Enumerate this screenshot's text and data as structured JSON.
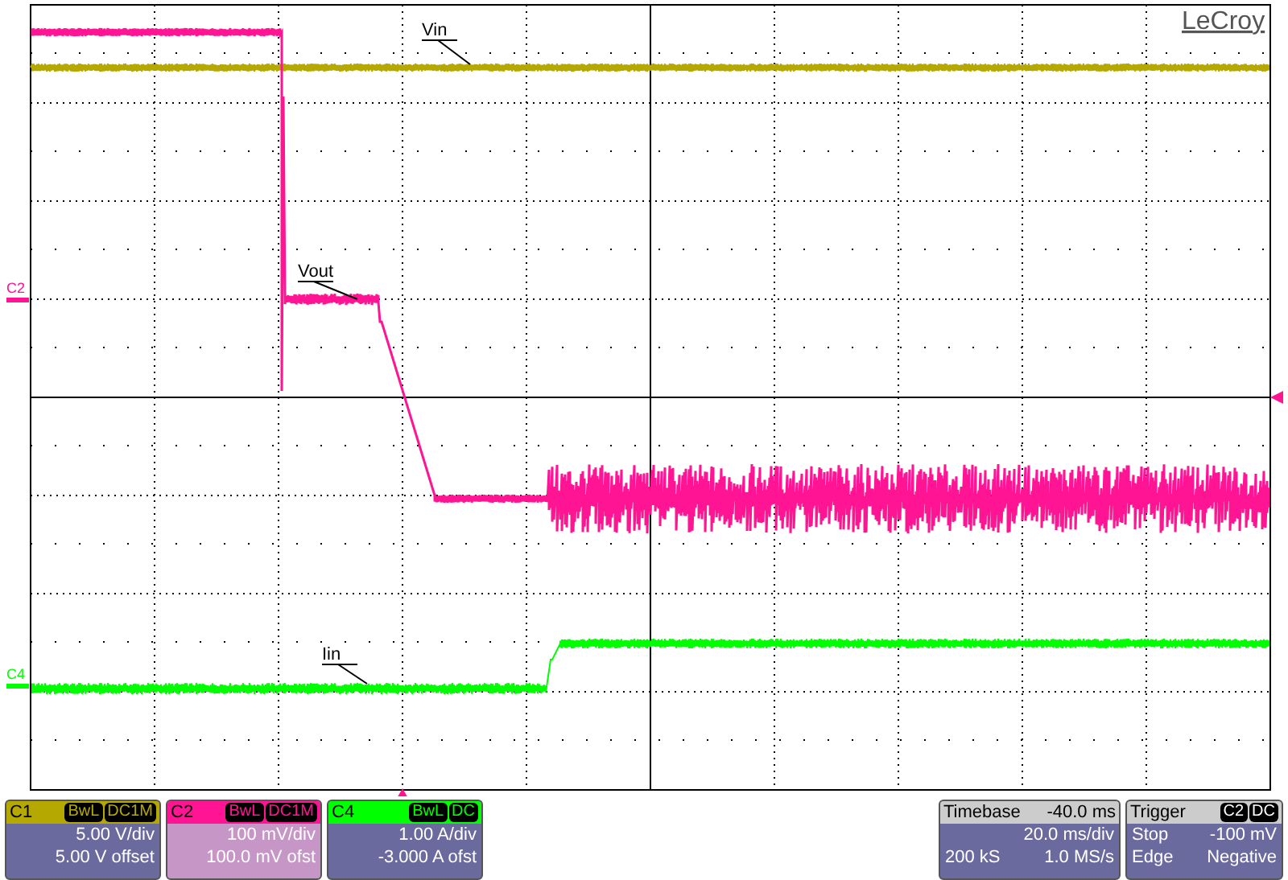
{
  "brand": "LeCroy",
  "traces": [
    {
      "kind": "supply",
      "color": "#b5a800",
      "label": "Vin"
    },
    {
      "kind": "output",
      "color": "#ff1493",
      "label": "Vout"
    },
    {
      "kind": "current",
      "color": "#00ff00",
      "label": "Iin"
    }
  ],
  "channel_markers": [
    {
      "label": "C2",
      "color": "#ff1493"
    },
    {
      "label": "C4",
      "color": "#00ff00"
    }
  ],
  "channels": [
    {
      "name": "C1",
      "color": "#b5a800",
      "badges": [
        "BwL",
        "DC1M"
      ],
      "lines": [
        "5.00 V/div",
        "5.00 V offset"
      ],
      "selected": false
    },
    {
      "name": "C2",
      "color": "#ff1493",
      "badges": [
        "BwL",
        "DC1M"
      ],
      "lines": [
        "100 mV/div",
        "100.0 mV ofst"
      ],
      "selected": true
    },
    {
      "name": "C4",
      "color": "#00ff00",
      "badges": [
        "BwL",
        "DC"
      ],
      "lines": [
        "1.00 A/div",
        "-3.000 A ofst"
      ],
      "selected": false
    }
  ],
  "timebase": {
    "title": "Timebase",
    "value": "-40.0 ms",
    "rows": [
      {
        "right": "20.0 ms/div"
      },
      {
        "left": "200 kS",
        "right": "1.0 MS/s"
      }
    ]
  },
  "trigger": {
    "title": "Trigger",
    "badges": [
      "C2",
      "DC"
    ],
    "rows": [
      {
        "left": "Stop",
        "right": "-100 mV"
      },
      {
        "left": "Edge",
        "right": "Negative"
      }
    ]
  }
}
